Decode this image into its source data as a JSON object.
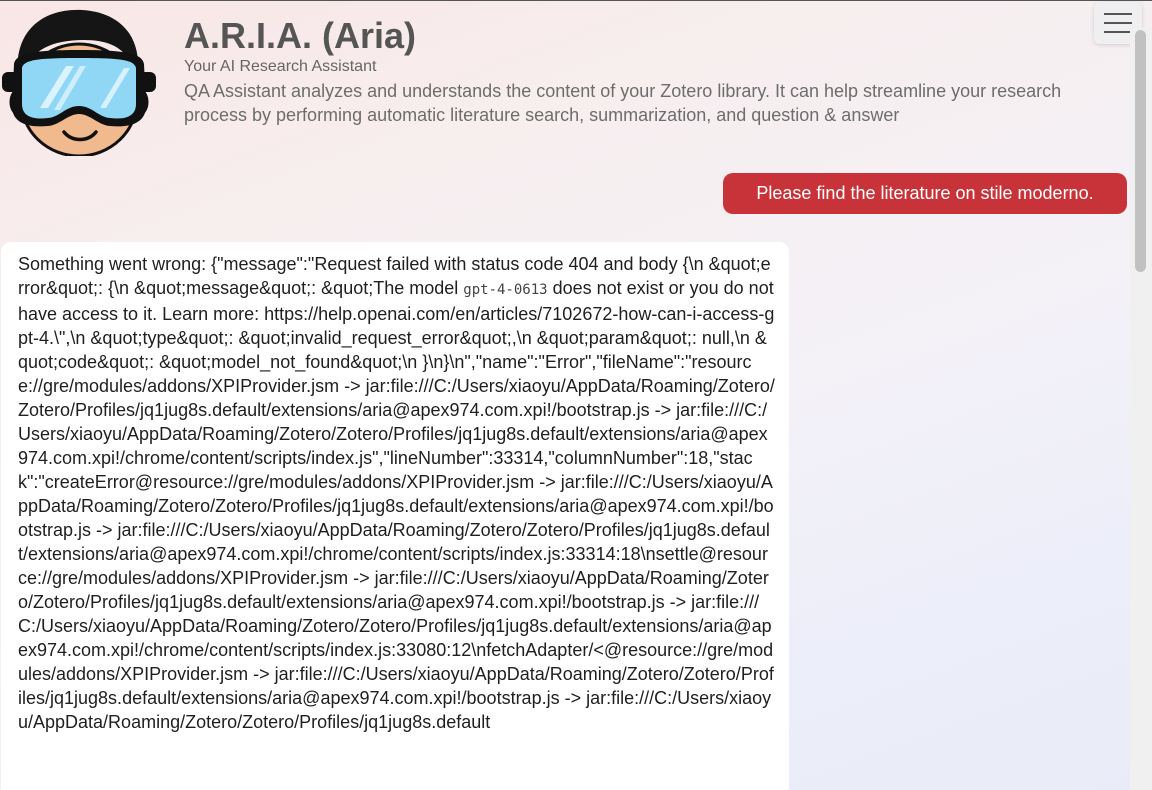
{
  "header": {
    "title": "A.R.I.A. (Aria)",
    "subtitle": "Your AI Research Assistant",
    "description": "QA Assistant analyzes and understands the content of your Zotero library. It can help streamline your research process by performing automatic literature search, summarization, and question & answer"
  },
  "icons": {
    "avatar": "goggles-avatar-icon",
    "menu": "hamburger-menu-icon"
  },
  "colors": {
    "user_bubble": "#c8333a",
    "bot_bubble": "#ffffff"
  },
  "messages": [
    {
      "role": "user",
      "text": "Please find the literature on stile moderno."
    },
    {
      "role": "assistant",
      "text_before_code": "Something went wrong: {\"message\":\"Request failed with status code 404 and body {\\n &quot;error&quot;: {\\n &quot;message&quot;: &quot;The model ",
      "code": "gpt-4-0613",
      "text_after_code": " does not exist or you do not have access to it. Learn more: https://help.openai.com/en/articles/7102672-how-can-i-access-gpt-4.\\\",\\n &quot;type&quot;: &quot;invalid_request_error&quot;,\\n &quot;param&quot;: null,\\n &quot;code&quot;: &quot;model_not_found&quot;\\n }\\n}\\n\",\"name\":\"Error\",\"fileName\":\"resource://gre/modules/addons/XPIProvider.jsm -> jar:file:///C:/Users/xiaoyu/AppData/Roaming/Zotero/Zotero/Profiles/jq1jug8s.default/extensions/aria@apex974.com.xpi!/bootstrap.js -> jar:file:///C:/Users/xiaoyu/AppData/Roaming/Zotero/Zotero/Profiles/jq1jug8s.default/extensions/aria@apex974.com.xpi!/chrome/content/scripts/index.js\",\"lineNumber\":33314,\"columnNumber\":18,\"stack\":\"createError@resource://gre/modules/addons/XPIProvider.jsm -> jar:file:///C:/Users/xiaoyu/AppData/Roaming/Zotero/Zotero/Profiles/jq1jug8s.default/extensions/aria@apex974.com.xpi!/bootstrap.js -> jar:file:///C:/Users/xiaoyu/AppData/Roaming/Zotero/Zotero/Profiles/jq1jug8s.default/extensions/aria@apex974.com.xpi!/chrome/content/scripts/index.js:33314:18\\nsettle@resource://gre/modules/addons/XPIProvider.jsm -> jar:file:///C:/Users/xiaoyu/AppData/Roaming/Zotero/Zotero/Profiles/jq1jug8s.default/extensions/aria@apex974.com.xpi!/bootstrap.js -> jar:file:///C:/Users/xiaoyu/AppData/Roaming/Zotero/Zotero/Profiles/jq1jug8s.default/extensions/aria@apex974.com.xpi!/chrome/content/scripts/index.js:33080:12\\nfetchAdapter/<@resource://gre/modules/addons/XPIProvider.jsm -> jar:file:///C:/Users/xiaoyu/AppData/Roaming/Zotero/Zotero/Profiles/jq1jug8s.default/extensions/aria@apex974.com.xpi!/bootstrap.js -> jar:file:///C:/Users/xiaoyu/AppData/Roaming/Zotero/Zotero/Profiles/jq1jug8s.default"
    }
  ]
}
